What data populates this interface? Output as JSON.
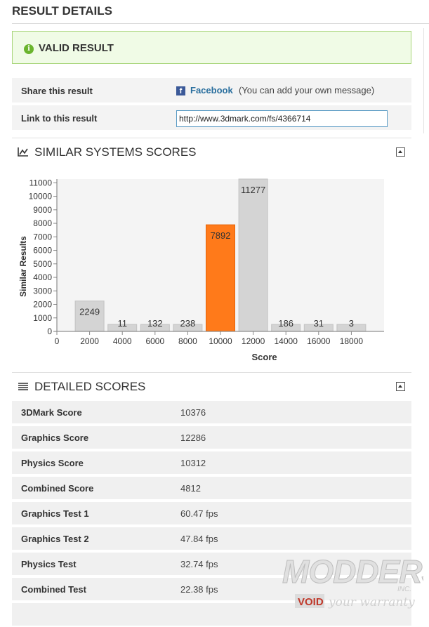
{
  "page_title": "RESULT DETAILS",
  "valid": {
    "label": "VALID RESULT",
    "icon": "info-icon",
    "color": "#6ab42d"
  },
  "share": {
    "share_label": "Share this result",
    "facebook_label": "Facebook",
    "facebook_note": "(You can add your own message)",
    "link_label": "Link to this result",
    "link_value": "http://www.3dmark.com/fs/4366714"
  },
  "similar": {
    "title": "SIMILAR SYSTEMS SCORES",
    "icon": "line-chart-icon"
  },
  "chart_data": {
    "type": "bar",
    "xlabel": "Score",
    "ylabel": "Similar Results",
    "x_ticks": [
      0,
      2000,
      4000,
      6000,
      8000,
      10000,
      12000,
      14000,
      16000,
      18000
    ],
    "y_ticks": [
      0,
      1000,
      2000,
      3000,
      4000,
      5000,
      6000,
      7000,
      8000,
      9000,
      10000,
      11000
    ],
    "xlim": [
      0,
      20000
    ],
    "ylim": [
      0,
      11277
    ],
    "bars": [
      {
        "x": 2000,
        "value": 2249
      },
      {
        "x": 4000,
        "value": 11
      },
      {
        "x": 6000,
        "value": 132
      },
      {
        "x": 8000,
        "value": 238
      },
      {
        "x": 10000,
        "value": 7892,
        "highlight": true
      },
      {
        "x": 12000,
        "value": 11277
      },
      {
        "x": 14000,
        "value": 186
      },
      {
        "x": 16000,
        "value": 31
      },
      {
        "x": 18000,
        "value": 3
      }
    ],
    "bar_color": "#d4d4d4",
    "highlight_color": "#ff7a1a"
  },
  "detailed": {
    "title": "DETAILED SCORES",
    "icon": "list-icon",
    "rows": [
      {
        "label": "3DMark Score",
        "value": "10376"
      },
      {
        "label": "Graphics Score",
        "value": "12286"
      },
      {
        "label": "Physics Score",
        "value": "10312"
      },
      {
        "label": "Combined Score",
        "value": "4812"
      },
      {
        "label": "Graphics Test 1",
        "value": "60.47 fps"
      },
      {
        "label": "Graphics Test 2",
        "value": "47.84 fps"
      },
      {
        "label": "Physics Test",
        "value": "32.74 fps"
      },
      {
        "label": "Combined Test",
        "value": "22.38 fps"
      },
      {
        "label": "",
        "value": ""
      }
    ]
  },
  "watermark": {
    "line1": "MODDERS",
    "inc": "INC.",
    "void": "VOID",
    "tagline": "your warranty"
  }
}
